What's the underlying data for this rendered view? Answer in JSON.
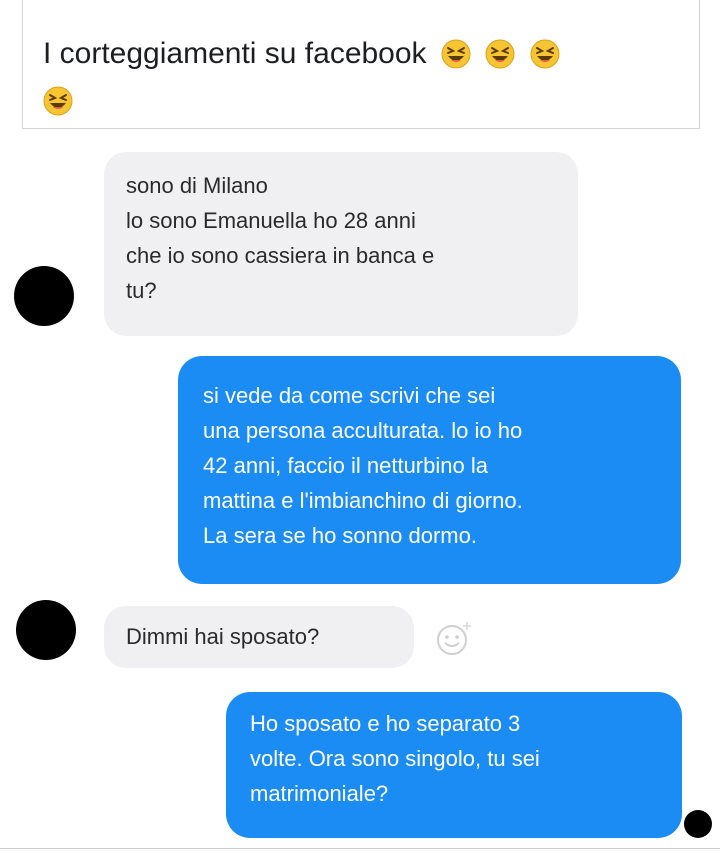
{
  "post": {
    "title": "I corteggiamenti su facebook",
    "emoji_icon": "laughing-emoji-icon"
  },
  "conversation": [
    {
      "side": "incoming",
      "lines": [
        "sono di  Milano",
        "lo sono Emanuella ho 28 anni",
        "che io sono cassiera in banca e",
        "tu?"
      ]
    },
    {
      "side": "outgoing",
      "lines": [
        "si vede da come scrivi che sei",
        "una persona acculturata. lo io ho",
        "42 anni, faccio il netturbino la",
        "mattina e l'imbianchino di giorno.",
        "La sera se ho sonno dormo."
      ]
    },
    {
      "side": "incoming",
      "lines": [
        "Dimmi hai sposato?"
      ]
    },
    {
      "side": "outgoing",
      "lines": [
        "Ho sposato e ho separato 3",
        "volte. Ora sono singolo, tu sei",
        "matrimoniale?"
      ]
    }
  ],
  "colors": {
    "outgoing_bubble": "#1a8cf3",
    "incoming_bubble": "#f0f0f2",
    "avatar": "#000000"
  }
}
